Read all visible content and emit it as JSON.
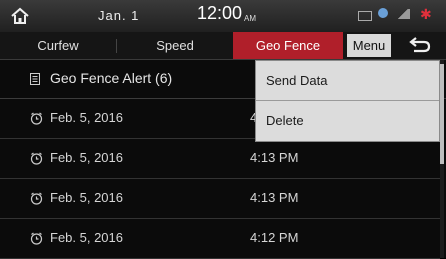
{
  "status": {
    "date": "Jan.  1",
    "time": "12:00",
    "ampm": "AM"
  },
  "tabs": [
    {
      "label": "Curfew"
    },
    {
      "label": "Speed"
    },
    {
      "label": "Geo Fence"
    }
  ],
  "active_tab": "Geo Fence",
  "menu_label": "Menu",
  "list": {
    "title": "Geo Fence Alert (6)",
    "rows": [
      {
        "date": "Feb. 5, 2016",
        "time": "4"
      },
      {
        "date": "Feb. 5, 2016",
        "time": "4:13 PM"
      },
      {
        "date": "Feb. 5, 2016",
        "time": "4:13 PM"
      },
      {
        "date": "Feb. 5, 2016",
        "time": "4:12 PM"
      }
    ]
  },
  "dropdown": {
    "items": [
      {
        "label": "Send Data"
      },
      {
        "label": "Delete"
      }
    ]
  },
  "colors": {
    "active_tab": "#b01f2a",
    "menu_bg": "#dcdcdc"
  }
}
